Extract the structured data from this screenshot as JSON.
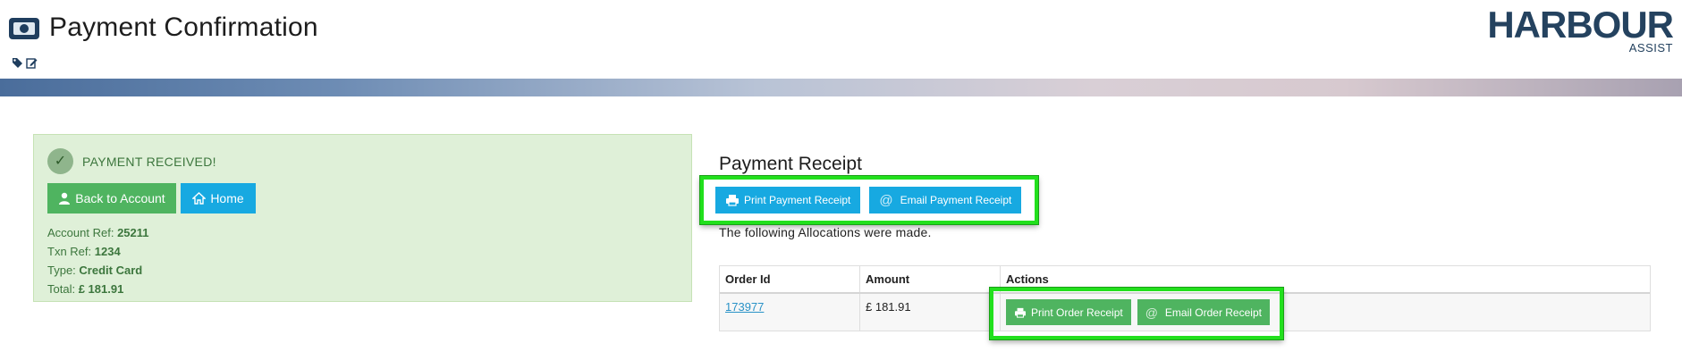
{
  "header": {
    "title": "Payment Confirmation",
    "logo_main": "HARBOUR",
    "logo_sub": "ASSIST"
  },
  "success": {
    "message": "PAYMENT RECEIVED!",
    "back_label": "Back to Account",
    "home_label": "Home",
    "fields": [
      {
        "label": "Account Ref:",
        "value": "25211"
      },
      {
        "label": "Txn Ref:",
        "value": "1234"
      },
      {
        "label": "Type:",
        "value": "Credit Card"
      },
      {
        "label": "Total:",
        "value": "£ 181.91"
      }
    ]
  },
  "receipt": {
    "title": "Payment Receipt",
    "print_label": "Print Payment Receipt",
    "email_label": "Email Payment Receipt",
    "allocations_text": "The following Allocations were made."
  },
  "table": {
    "headers": [
      "Order Id",
      "Amount",
      "Actions"
    ],
    "rows": [
      {
        "order_id": "173977",
        "amount": "£ 181.91",
        "print_label": "Print Order Receipt",
        "email_label": "Email Order Receipt"
      }
    ]
  },
  "colors": {
    "green_button": "#4fb460",
    "blue_button": "#17a9e1",
    "success_bg": "#dff0d8",
    "highlight": "#22e01d"
  },
  "icons": [
    "money-icon",
    "tag-icon",
    "edit-icon",
    "check-icon",
    "user-icon",
    "home-icon",
    "print-icon",
    "at-icon"
  ]
}
